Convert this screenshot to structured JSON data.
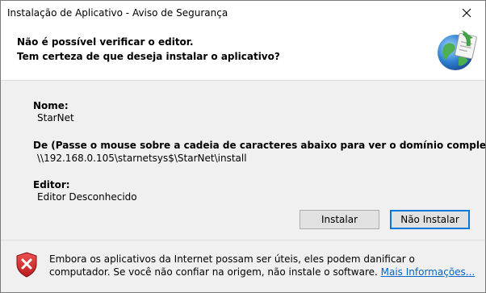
{
  "window": {
    "title": "Instalação de Aplicativo - Aviso de Segurança",
    "close_glyph": "✕"
  },
  "header": {
    "line1": "Não é possível verificar o editor.",
    "line2": "Tem certeza de que deseja instalar o aplicativo?",
    "icon": "globe-install-icon"
  },
  "fields": {
    "name_label": "Nome:",
    "name_value": "StarNet",
    "from_label": "De (Passe o mouse sobre a cadeia de caracteres abaixo para ver o domínio completo):",
    "from_value": "\\\\192.168.0.105\\starnetsys$\\StarNet\\install",
    "publisher_label": "Editor:",
    "publisher_value": "Editor Desconhecido"
  },
  "buttons": {
    "install": "Instalar",
    "dont_install": "Não Instalar"
  },
  "footer": {
    "warning_text": "Embora os aplicativos da Internet possam ser úteis, eles podem danificar o computador. Se você não confiar na origem, não instale o software.",
    "more_info_link": "Mais Informações...",
    "icon": "shield-warning-icon"
  },
  "colors": {
    "accent": "#0078d7",
    "link": "#0066cc",
    "shield_red": "#d32f2f"
  }
}
